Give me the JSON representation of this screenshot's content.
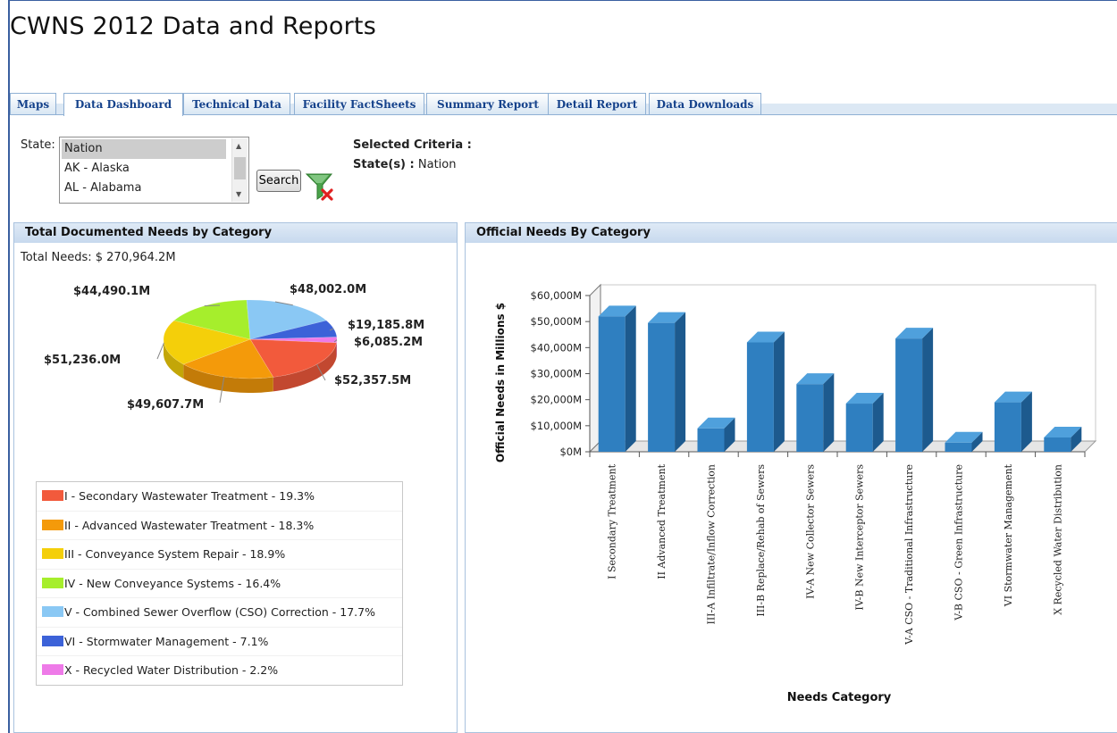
{
  "page_title": "CWNS 2012 Data and Reports",
  "tabs": [
    {
      "label": "Maps",
      "active": false
    },
    {
      "label": "Data Dashboard",
      "active": true
    },
    {
      "label": "Technical Data",
      "active": false
    },
    {
      "label": "Facility FactSheets",
      "active": false
    },
    {
      "label": "Summary Report",
      "active": false
    },
    {
      "label": "Detail Report",
      "active": false
    },
    {
      "label": "Data Downloads",
      "active": false
    }
  ],
  "filter": {
    "state_label": "State:",
    "options": [
      "Nation",
      "AK - Alaska",
      "AL - Alabama"
    ],
    "selected": "Nation",
    "search_label": "Search",
    "clear_filter_icon": "funnel-clear-icon"
  },
  "criteria": {
    "title": "Selected Criteria :",
    "state_key": "State(s) :",
    "state_value": "Nation"
  },
  "left_panel": {
    "title": "Total Documented Needs by Category",
    "total_label": "Total Needs: $ 270,964.2M"
  },
  "right_panel": {
    "title": "Official Needs By Category"
  },
  "colors": {
    "tab_text": "#15428b",
    "panel_header": "#c7d9ee",
    "bar": "#2f7fc0"
  },
  "chart_data": [
    {
      "type": "pie",
      "title": "Total Documented Needs by Category",
      "slices": [
        {
          "label": "I - Secondary Wastewater Treatment - 19.3%",
          "value": 52357.5,
          "value_label": "$52,357.5M",
          "color": "#f25a3c"
        },
        {
          "label": "II - Advanced Wastewater Treatment - 18.3%",
          "value": 49607.7,
          "value_label": "$49,607.7M",
          "color": "#f49a0a"
        },
        {
          "label": "III - Conveyance System Repair - 18.9%",
          "value": 51236.0,
          "value_label": "$51,236.0M",
          "color": "#f4cf0a"
        },
        {
          "label": "IV - New Conveyance Systems - 16.4%",
          "value": 44490.1,
          "value_label": "$44,490.1M",
          "color": "#a6ee2c"
        },
        {
          "label": "V - Combined Sewer Overflow (CSO) Correction - 17.7%",
          "value": 48002.0,
          "value_label": "$48,002.0M",
          "color": "#8ac8f4"
        },
        {
          "label": "VI - Stormwater Management - 7.1%",
          "value": 19185.8,
          "value_label": "$19,185.8M",
          "color": "#3c62d8"
        },
        {
          "label": "X - Recycled Water Distribution - 2.2%",
          "value": 6085.2,
          "value_label": "$6,085.2M",
          "color": "#ee7ae8"
        }
      ],
      "legend_position": "bottom"
    },
    {
      "type": "bar",
      "title": "Official Needs By Category",
      "xlabel": "Needs Category",
      "ylabel": "Official Needs in Millions $",
      "ylim": [
        0,
        60000
      ],
      "yticks": [
        "$0M",
        "$10,000M",
        "$20,000M",
        "$30,000M",
        "$40,000M",
        "$50,000M",
        "$60,000M"
      ],
      "categories": [
        "I Secondary Treatment",
        "II Advanced Treatment",
        "III-A Infiltrate/Inflow Correction",
        "III-B Replace/Rehab of Sewers",
        "IV-A New Collector Sewers",
        "IV-B New Interceptor Sewers",
        "V-A CSO - Traditional Infrastructure",
        "V-B CSO - Green Infrastructure",
        "VI Stormwater Management",
        "X Recycled Water Distribution"
      ],
      "values": [
        52000,
        49500,
        9000,
        42000,
        26000,
        18500,
        43500,
        3500,
        19000,
        5500
      ],
      "grid": false
    }
  ]
}
